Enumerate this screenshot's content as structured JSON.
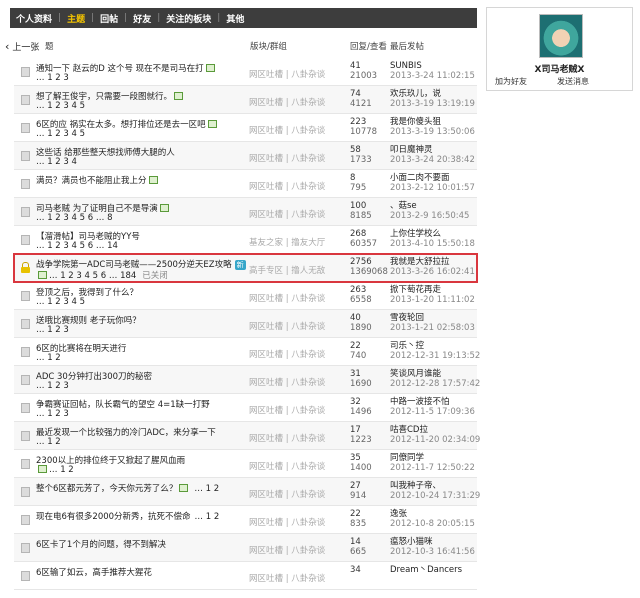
{
  "nav": {
    "items": [
      {
        "label": "个人资料",
        "active": false
      },
      {
        "label": "主题",
        "active": true
      },
      {
        "label": "回帖",
        "active": false
      },
      {
        "label": "好友",
        "active": false
      },
      {
        "label": "关注的板块",
        "active": false
      },
      {
        "label": "其他",
        "active": false
      }
    ]
  },
  "back_label": "上一张",
  "columns": {
    "title": "题",
    "forum": "版块/群组",
    "stats": "回复/查看",
    "last": "最后发帖"
  },
  "profile": {
    "username": "X司马老贼X",
    "add_friend": "加为好友",
    "send_message": "发送消息"
  },
  "colors": {
    "nav_bg": "#3d3d3d",
    "nav_active": "#f3c300",
    "highlight_border": "#d9363e"
  },
  "threads": [
    {
      "title": "通知一下 赵云的D 这个号 现在不是司马在打",
      "pages": "… 1 2 3",
      "forum": "网区吐槽 | 八卦杂谈",
      "replies": "41",
      "views": "21003",
      "last_user": "SUNBIS",
      "last_time": "2013-3-24 11:02:15",
      "icon": "doc",
      "img_after_title": true,
      "img_after_pages": false
    },
    {
      "title": "想了解王俊宇，只需要一段图就行。",
      "pages": "… 1 2 3 4 5",
      "forum": "网区吐槽 | 八卦杂谈",
      "replies": "74",
      "views": "4121",
      "last_user": "欢乐玖儿，说",
      "last_time": "2013-3-19 13:19:19",
      "icon": "doc",
      "img_after_title": true,
      "img_after_pages": false
    },
    {
      "title": "6区的应 祸实在太多。想打排位还是去一区吧",
      "pages": "… 1 2 3 4 5",
      "forum": "网区吐槽 | 八卦杂谈",
      "replies": "223",
      "views": "10778",
      "last_user": "我是你傻头狙",
      "last_time": "2013-3-19 13:50:06",
      "icon": "doc",
      "img_after_title": true,
      "img_after_pages": false
    },
    {
      "title": "这些话 给那些整天想找师傅大腿的人",
      "pages": "… 1 2 3 4",
      "forum": "网区吐槽 | 八卦杂谈",
      "replies": "58",
      "views": "1733",
      "last_user": "叩日魔神灵",
      "last_time": "2013-3-24 20:38:42",
      "icon": "doc",
      "img_after_title": false,
      "img_after_pages": false
    },
    {
      "title": "满员？满员也不能阻止我上分",
      "pages": "",
      "forum": "网区吐槽 | 八卦杂谈",
      "replies": "8",
      "views": "795",
      "last_user": "小面二肉不要面",
      "last_time": "2013-2-12 10:01:57",
      "icon": "doc",
      "img_after_title": true,
      "img_after_pages": false
    },
    {
      "title": "司马老贼 为了证明自己不是导演",
      "pages": "… 1 2 3 4 5 6 … 8",
      "forum": "网区吐槽 | 八卦杂谈",
      "replies": "100",
      "views": "8185",
      "last_user": "、菇se",
      "last_time": "2013-2-9 16:50:45",
      "icon": "doc",
      "img_after_title": true,
      "img_after_pages": false
    },
    {
      "title": "【溜滑帖】司马老贼的YY号",
      "pages": "… 1 2 3 4 5 6 … 14",
      "forum": "基友之家 | 撸友大厅",
      "replies": "268",
      "views": "60357",
      "last_user": "上你住学校么",
      "last_time": "2013-4-10 15:50:18",
      "icon": "doc",
      "img_after_title": false,
      "img_after_pages": false
    },
    {
      "title": "战争学院第一ADC司马老贼——2500分逆天EZ攻略",
      "pages": "… 1 2 3 4 5 6 … 184",
      "forum": "高手专区 | 撸人无敌",
      "replies": "2756",
      "views": "1369068",
      "last_user": "我就是大舒拉拉",
      "last_time": "2013-3-26 16:02:41",
      "icon": "lock",
      "img_after_title": false,
      "img_after_pages": true,
      "badge": "新",
      "status": "已关闭",
      "highlighted": true
    },
    {
      "title": "登顶之后，我得到了什么？",
      "pages": "… 1 2 3 4 5",
      "forum": "网区吐槽 | 八卦杂谈",
      "replies": "263",
      "views": "6558",
      "last_user": "掀下萄花再走",
      "last_time": "2013-1-20 11:11:02",
      "icon": "doc",
      "img_after_title": false,
      "img_after_pages": false
    },
    {
      "title": "送哦比赛规则 老子玩你吗？",
      "pages": "… 1 2 3",
      "forum": "网区吐槽 | 八卦杂谈",
      "replies": "40",
      "views": "1890",
      "last_user": "雪夜轮回",
      "last_time": "2013-1-21 02:58:03",
      "icon": "doc",
      "img_after_title": false,
      "img_after_pages": false
    },
    {
      "title": "6区的比赛将在明天进行",
      "pages": "… 1 2",
      "forum": "网区吐槽 | 八卦杂谈",
      "replies": "22",
      "views": "740",
      "last_user": "司乐丶控",
      "last_time": "2012-12-31 19:13:52",
      "icon": "doc",
      "img_after_title": false,
      "img_after_pages": false
    },
    {
      "title": "ADC 30分钟打出300刀的秘密",
      "pages": "… 1 2 3",
      "forum": "网区吐槽 | 八卦杂谈",
      "replies": "31",
      "views": "1690",
      "last_user": "笑谈风月谁能",
      "last_time": "2012-12-28 17:57:42",
      "icon": "doc",
      "img_after_title": false,
      "img_after_pages": false
    },
    {
      "title": "争霸赛证回帖，队长霸气的望空 4=1缺一打野",
      "pages": "… 1 2 3",
      "forum": "网区吐槽 | 八卦杂谈",
      "replies": "32",
      "views": "1496",
      "last_user": "中路一波接不怕",
      "last_time": "2012-11-5 17:09:36",
      "icon": "doc",
      "img_after_title": false,
      "img_after_pages": false
    },
    {
      "title": "最近发现一个比较强力的冷门ADC，来分享一下",
      "pages": "… 1 2",
      "forum": "网区吐槽 | 八卦杂谈",
      "replies": "17",
      "views": "1223",
      "last_user": "咕喜CD拉",
      "last_time": "2012-11-20 02:34:09",
      "icon": "doc",
      "img_after_title": false,
      "img_after_pages": false
    },
    {
      "title": "2300以上的排位终于又掀起了腥风血雨",
      "pages": "… 1 2",
      "forum": "网区吐槽 | 八卦杂谈",
      "replies": "35",
      "views": "1400",
      "last_user": "同僚同学",
      "last_time": "2012-11-7 12:50:22",
      "icon": "doc",
      "img_after_title": false,
      "img_after_pages": true
    },
    {
      "title": "整个6区都元芳了，今天你元芳了么？",
      "pages": "",
      "forum": "网区吐槽 | 八卦杂谈",
      "replies": "27",
      "views": "914",
      "last_user": "叫我种子帝、",
      "last_time": "2012-10-24 17:31:29",
      "icon": "doc",
      "img_after_title": true,
      "img_after_pages": false,
      "inline_pages": "… 1 2"
    },
    {
      "title": "现在电6有很多2000分新秀，抗死不偿命",
      "pages": "",
      "forum": "网区吐槽 | 八卦杂谈",
      "replies": "22",
      "views": "835",
      "last_user": "逸张",
      "last_time": "2012-10-8 20:05:15",
      "icon": "doc",
      "img_after_title": false,
      "img_after_pages": false,
      "inline_pages": "… 1 2"
    },
    {
      "title": "6区卡了1个月的问题，得不到解决",
      "pages": "",
      "forum": "网区吐槽 | 八卦杂谈",
      "replies": "14",
      "views": "665",
      "last_user": "瘟怒小猫咪",
      "last_time": "2012-10-3 16:41:56",
      "icon": "doc",
      "img_after_title": false,
      "img_after_pages": false
    },
    {
      "title": "6区输了如云，高手推荐大猩花",
      "pages": "",
      "forum": "网区吐槽 | 八卦杂谈",
      "replies": "34",
      "views": "",
      "last_user": "Dream丶Dancers",
      "last_time": "",
      "icon": "doc",
      "img_after_title": false,
      "img_after_pages": false
    }
  ]
}
